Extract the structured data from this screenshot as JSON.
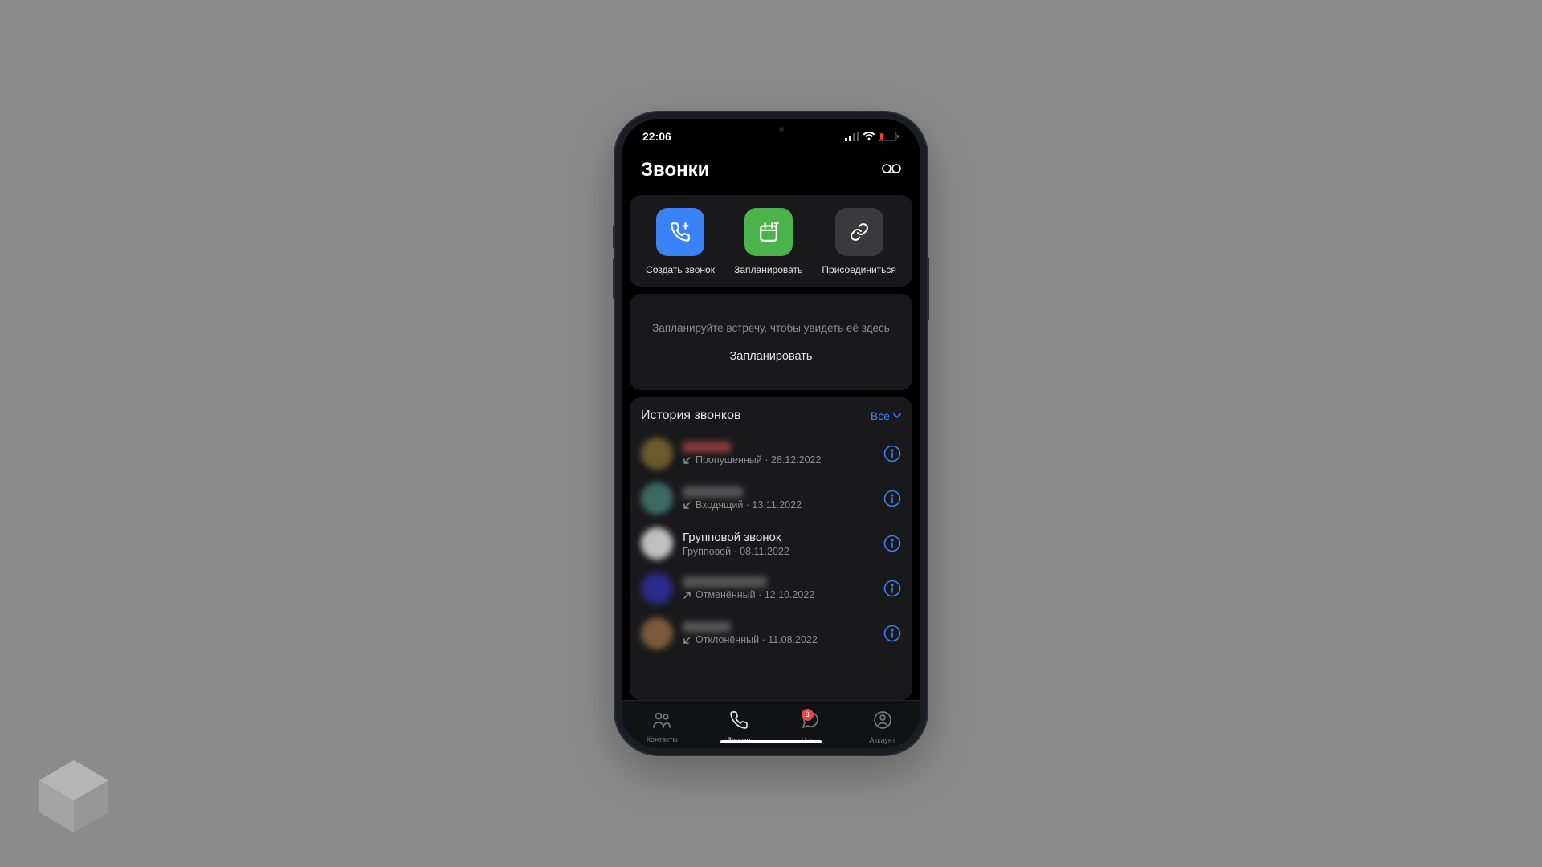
{
  "statusbar": {
    "time": "22:06"
  },
  "header": {
    "title": "Звонки"
  },
  "actions": [
    {
      "label": "Создать звонок"
    },
    {
      "label": "Запланировать"
    },
    {
      "label": "Присоединиться"
    }
  ],
  "schedule": {
    "hint": "Запланируйте встречу, чтобы увидеть её здесь",
    "button": "Запланировать"
  },
  "history": {
    "title": "История звонков",
    "filter": "Все",
    "items": [
      {
        "name": "",
        "name_redacted": true,
        "avatar_color": "#6b5a2b",
        "status": "Пропущенный",
        "date": "28.12.2022",
        "direction": "in",
        "missed": true
      },
      {
        "name": "",
        "name_redacted": true,
        "avatar_color": "#3c6a62",
        "status": "Входящий",
        "date": "13.11.2022",
        "direction": "in",
        "missed": false
      },
      {
        "name": "Групповой звонок",
        "name_redacted": false,
        "avatar_color": "#bfbfbf",
        "status": "Групповой",
        "date": "08.11.2022",
        "direction": "none",
        "missed": false
      },
      {
        "name": "",
        "name_redacted": true,
        "avatar_color": "#2a2a8a",
        "status": "Отменённый",
        "date": "12.10.2022",
        "direction": "out",
        "missed": false
      },
      {
        "name": "",
        "name_redacted": true,
        "avatar_color": "#7a5a3a",
        "status": "Отклонённый",
        "date": "11.08.2022",
        "direction": "in",
        "missed": false
      }
    ]
  },
  "tabs": [
    {
      "label": "Контакты",
      "active": false,
      "badge": null
    },
    {
      "label": "Звонки",
      "active": true,
      "badge": null
    },
    {
      "label": "Чаты",
      "active": false,
      "badge": "3"
    },
    {
      "label": "Аккаунт",
      "active": false,
      "badge": null
    }
  ],
  "colors": {
    "accent_blue": "#3a82f7",
    "accent_green": "#4bb34b",
    "bg_card": "#19191b",
    "text": "#e1e3e6",
    "text_secondary": "#8b8d92"
  }
}
